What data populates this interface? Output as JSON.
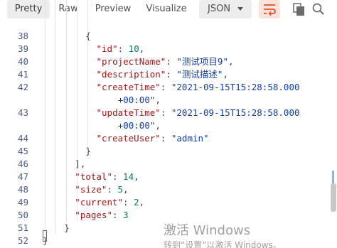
{
  "toolbar": {
    "tabs": [
      {
        "label": "Pretty",
        "selected": true
      },
      {
        "label": "Raw",
        "selected": false
      },
      {
        "label": "Preview",
        "selected": false
      },
      {
        "label": "Visualize",
        "selected": false
      }
    ],
    "format_select": {
      "value": "JSON"
    },
    "icons": {
      "wrap": "wrap-lines-icon",
      "copy": "copy-icon",
      "search": "search-icon"
    }
  },
  "editor": {
    "lines": [
      {
        "num": "38",
        "indent": 4,
        "tokens": [
          {
            "t": "{",
            "c": "p"
          }
        ]
      },
      {
        "num": "39",
        "indent": 5,
        "tokens": [
          {
            "t": "\"id\"",
            "c": "k"
          },
          {
            "t": ": ",
            "c": "p"
          },
          {
            "t": "10",
            "c": "n"
          },
          {
            "t": ",",
            "c": "p"
          }
        ]
      },
      {
        "num": "40",
        "indent": 5,
        "tokens": [
          {
            "t": "\"projectName\"",
            "c": "k"
          },
          {
            "t": ": ",
            "c": "p"
          },
          {
            "t": "\"测试项目9\"",
            "c": "s"
          },
          {
            "t": ",",
            "c": "p"
          }
        ]
      },
      {
        "num": "41",
        "indent": 5,
        "tokens": [
          {
            "t": "\"description\"",
            "c": "k"
          },
          {
            "t": ": ",
            "c": "p"
          },
          {
            "t": "\"测试描述\"",
            "c": "s"
          },
          {
            "t": ",",
            "c": "p"
          }
        ]
      },
      {
        "num": "42",
        "indent": 5,
        "tokens": [
          {
            "t": "\"createTime\"",
            "c": "k"
          },
          {
            "t": ": ",
            "c": "p"
          },
          {
            "t": "\"2021-09-15T15:28:58.000",
            "c": "s"
          }
        ]
      },
      {
        "num": "",
        "indent": 7,
        "tokens": [
          {
            "t": "+00:00\"",
            "c": "s"
          },
          {
            "t": ",",
            "c": "p"
          }
        ]
      },
      {
        "num": "43",
        "indent": 5,
        "tokens": [
          {
            "t": "\"updateTime\"",
            "c": "k"
          },
          {
            "t": ": ",
            "c": "p"
          },
          {
            "t": "\"2021-09-15T15:28:58.000",
            "c": "s"
          }
        ]
      },
      {
        "num": "",
        "indent": 7,
        "tokens": [
          {
            "t": "+00:00\"",
            "c": "s"
          },
          {
            "t": ",",
            "c": "p"
          }
        ]
      },
      {
        "num": "44",
        "indent": 5,
        "tokens": [
          {
            "t": "\"createUser\"",
            "c": "k"
          },
          {
            "t": ": ",
            "c": "p"
          },
          {
            "t": "\"admin\"",
            "c": "s"
          }
        ]
      },
      {
        "num": "45",
        "indent": 4,
        "tokens": [
          {
            "t": "}",
            "c": "p"
          }
        ]
      },
      {
        "num": "46",
        "indent": 3,
        "tokens": [
          {
            "t": "],",
            "c": "p"
          }
        ]
      },
      {
        "num": "47",
        "indent": 3,
        "tokens": [
          {
            "t": "\"total\"",
            "c": "k"
          },
          {
            "t": ": ",
            "c": "p"
          },
          {
            "t": "14",
            "c": "n"
          },
          {
            "t": ",",
            "c": "p"
          }
        ]
      },
      {
        "num": "48",
        "indent": 3,
        "tokens": [
          {
            "t": "\"size\"",
            "c": "k"
          },
          {
            "t": ": ",
            "c": "p"
          },
          {
            "t": "5",
            "c": "n"
          },
          {
            "t": ",",
            "c": "p"
          }
        ]
      },
      {
        "num": "49",
        "indent": 3,
        "tokens": [
          {
            "t": "\"current\"",
            "c": "k"
          },
          {
            "t": ": ",
            "c": "p"
          },
          {
            "t": "2",
            "c": "n"
          },
          {
            "t": ",",
            "c": "p"
          }
        ]
      },
      {
        "num": "50",
        "indent": 3,
        "tokens": [
          {
            "t": "\"pages\"",
            "c": "k"
          },
          {
            "t": ": ",
            "c": "p"
          },
          {
            "t": "3",
            "c": "n"
          }
        ]
      },
      {
        "num": "51",
        "indent": 2,
        "tokens": [
          {
            "t": "}",
            "c": "p"
          }
        ]
      },
      {
        "num": "52",
        "indent": 0,
        "tokens": [
          {
            "t": "}",
            "c": "p"
          }
        ]
      }
    ]
  },
  "watermark": {
    "title": "激活 Windows",
    "subtitle": "转到“设置”以激活 Windows。"
  },
  "colors": {
    "key": "#a0171a",
    "string": "#0f3ea8",
    "number": "#047d65",
    "wrap_active_bg": "#fbe3dc",
    "wrap_icon": "#e0542a"
  }
}
